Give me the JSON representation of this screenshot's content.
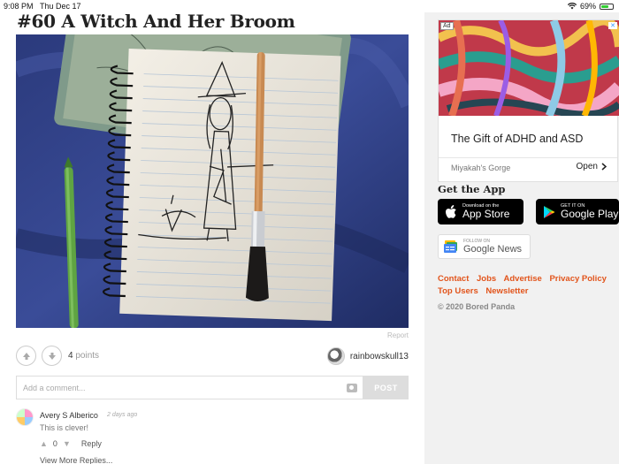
{
  "status_bar": {
    "time": "9:08 PM",
    "date": "Thu Dec 17",
    "battery": "69%",
    "battery_level": 0.69
  },
  "post": {
    "title": "#60 A Witch And Her Broom",
    "report_label": "Report",
    "points_count": "4",
    "points_label": "points",
    "author": "rainbowskull13"
  },
  "comment_form": {
    "placeholder": "Add a comment...",
    "post_label": "POST"
  },
  "comments": [
    {
      "author": "Avery S Alberico",
      "time": "2 days ago",
      "text": "This is clever!",
      "votes": "0",
      "reply_label": "Reply"
    }
  ],
  "view_more_label": "View More Replies...",
  "sidebar": {
    "ad": {
      "badge": "Ad",
      "close": "✕",
      "headline": "The Gift of ADHD and ASD",
      "source": "Miyakah's Gorge",
      "open_label": "Open"
    },
    "get_app_title": "Get the App",
    "app_store": {
      "small": "Download on the",
      "big": "App Store"
    },
    "google_play": {
      "small": "GET IT ON",
      "big": "Google Play"
    },
    "google_news": {
      "small": "FOLLOW ON",
      "big": "Google News"
    },
    "links": [
      "Contact",
      "Jobs",
      "Advertise",
      "Privacy Policy",
      "Top Users",
      "Newsletter"
    ],
    "copyright": "© 2020 Bored Panda"
  },
  "colors": {
    "accent": "#e2541b",
    "photo_background": "#2e3f86"
  },
  "icons": [
    "wifi-icon",
    "battery-icon",
    "upvote-icon",
    "downvote-icon",
    "camera-icon",
    "apple-icon",
    "google-play-icon",
    "google-news-icon",
    "chevron-right-icon"
  ]
}
